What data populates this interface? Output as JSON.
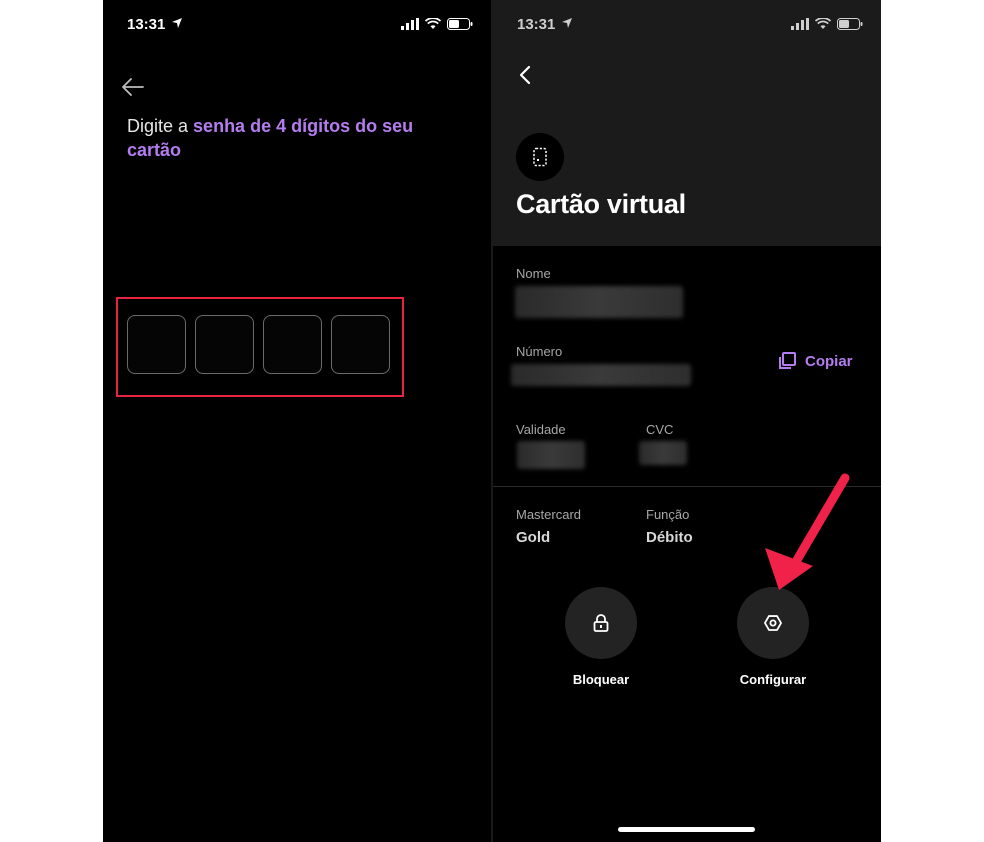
{
  "status_bar": {
    "time": "13:31"
  },
  "pin_screen": {
    "prompt_prefix": "Digite a ",
    "prompt_highlight": "senha de 4 dígitos do seu cartão",
    "pin_digits": [
      "",
      "",
      "",
      ""
    ]
  },
  "card_screen": {
    "title": "Cartão virtual",
    "fields": {
      "name_label": "Nome",
      "number_label": "Número",
      "validity_label": "Validade",
      "cvc_label": "CVC"
    },
    "copy_label": "Copiar",
    "brand_label": "Mastercard",
    "brand_value": "Gold",
    "function_label": "Função",
    "function_value": "Débito",
    "actions": {
      "block": "Bloquear",
      "configure": "Configurar"
    }
  },
  "colors": {
    "accent": "#b57cf0",
    "highlight_red": "#e8253f",
    "arrow_red": "#f0224a"
  }
}
